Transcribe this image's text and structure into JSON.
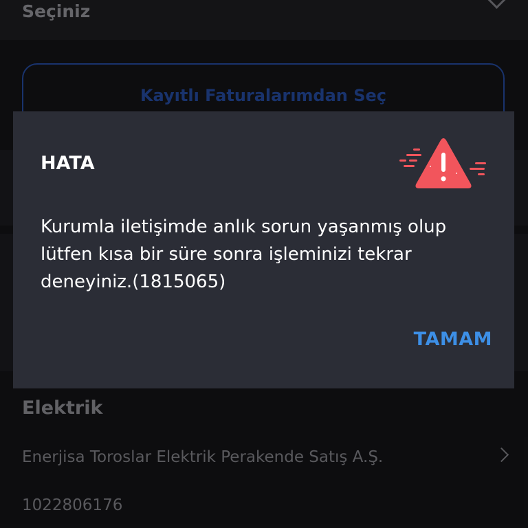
{
  "background": {
    "select_label": "Seçiniz",
    "saved_bills_button": "Kayıtlı Faturalarımdan Seç",
    "section_title": "Elektrik",
    "company_name": "Enerjisa Toroslar Elektrik Perakende Satış A.Ş.",
    "subscriber_number": "1022806176"
  },
  "dialog": {
    "title": "HATA",
    "message": "Kurumla iletişimde anlık sorun yaşanmış olup lütfen kısa bir süre sonra işleminizi tekrar deneyiniz.(1815065)",
    "ok_label": "TAMAM",
    "icon": "warning-triangle-icon"
  },
  "colors": {
    "dialog_bg": "#2b2d36",
    "accent": "#3d8fe6",
    "warning": "#f2555c",
    "saved_bills_border": "#1f3f86"
  }
}
